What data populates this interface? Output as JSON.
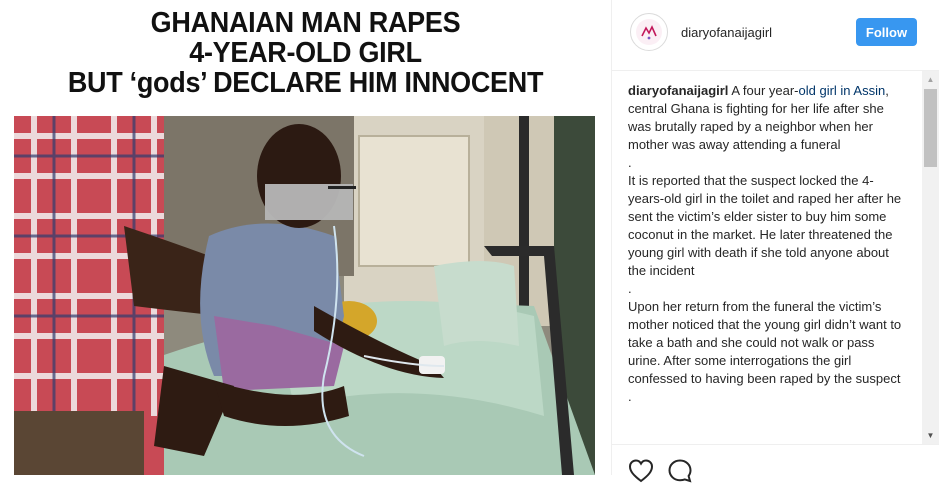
{
  "post": {
    "headline_lines": [
      "GHANAIAN MAN RAPES",
      "4-YEAR-OLD GIRL",
      "BUT ‘gods’ DECLARE HIM INNOCENT"
    ]
  },
  "header": {
    "username": "diaryofanaijagirl",
    "follow_label": "Follow",
    "avatar_icon": "profile-avatar"
  },
  "caption": {
    "username": "diaryofanaijagirl",
    "intro_prefix": " A four year-",
    "intro_link": "old girl in Assin",
    "intro_suffix": ", central Ghana is fighting for her life after she was brutally raped by a neighbor when her mother was away attending a funeral",
    "dot1": ".",
    "paragraph2": "It is reported that the suspect locked the 4-years-old girl in the toilet and raped her after he sent the victim’s elder sister to buy him some coconut in the market. He later threatened the young girl with death if she told anyone about the incident",
    "dot2": ".",
    "paragraph3": "Upon her return from the funeral the victim’s mother noticed that the young girl didn’t want to take a bath and she could not walk or pass urine. After some interrogations the girl confessed to having been raped by the suspect",
    "dot3": "."
  },
  "actions": {
    "icons": [
      "heart-icon",
      "comment-icon"
    ]
  },
  "colors": {
    "follow_button": "#3897f0",
    "link": "#003569",
    "text": "#262626",
    "border": "#efefef"
  }
}
